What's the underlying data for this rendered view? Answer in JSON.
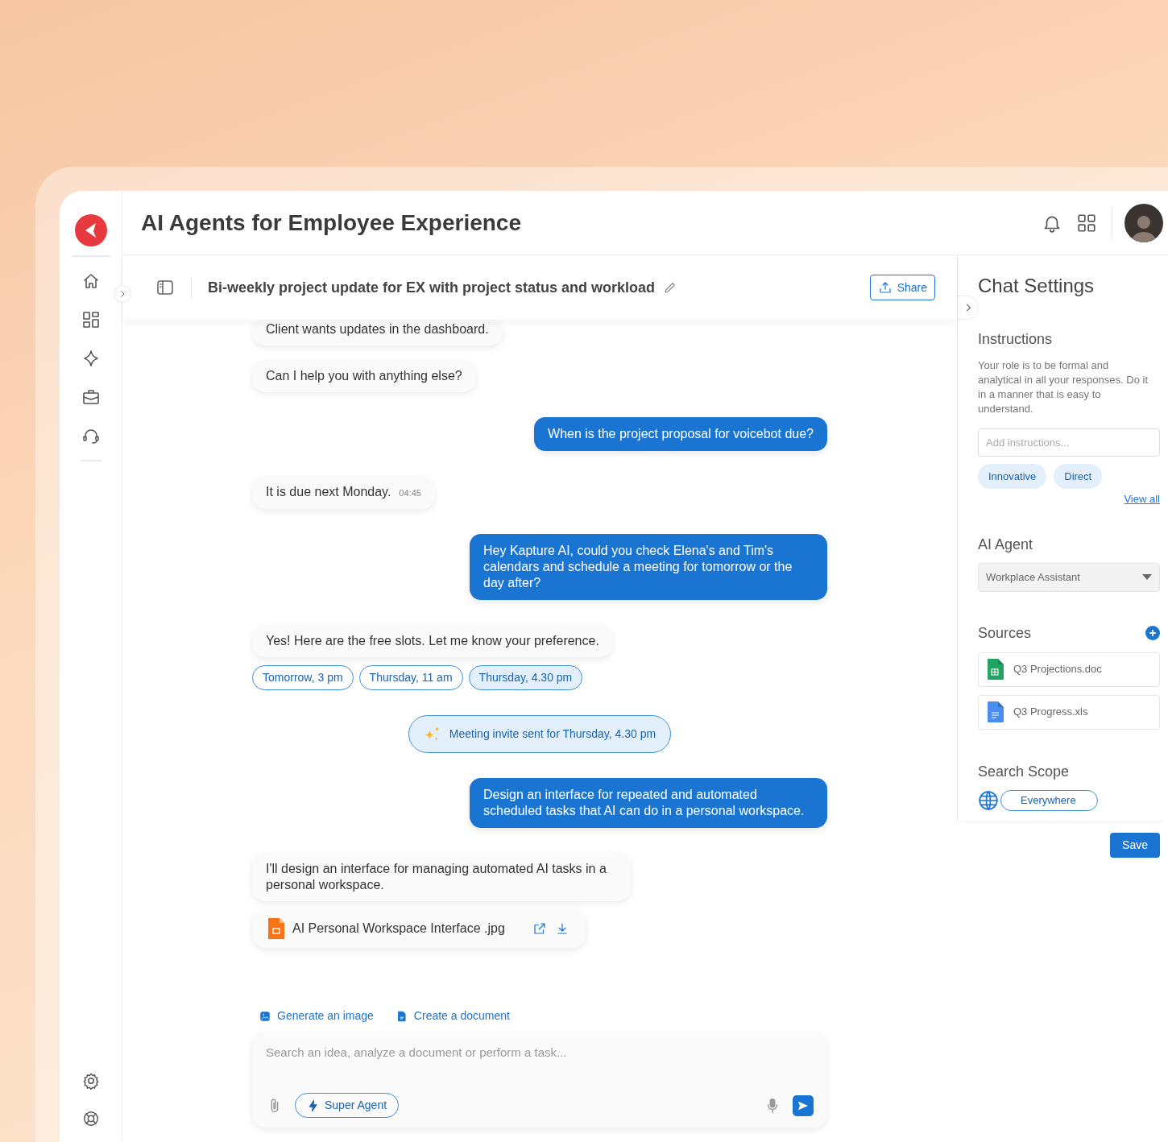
{
  "app": {
    "title": "AI Agents for Employee Experience"
  },
  "chat": {
    "title": "Bi-weekly project update for EX with project status and workload",
    "share_label": "Share",
    "messages": [
      {
        "kind": "bot",
        "text": "Client wants updates in the dashboard."
      },
      {
        "kind": "bot",
        "text": "Can I help you with anything else?"
      },
      {
        "kind": "user",
        "text": "When is the project proposal for voicebot due?"
      },
      {
        "kind": "bot",
        "text": "It is due next Monday.",
        "time": "04:45"
      },
      {
        "kind": "user",
        "text": "Hey Kapture AI, could you check Elena's and Tim's calendars and schedule a meeting for tomorrow or the day after?"
      },
      {
        "kind": "bot",
        "text": "Yes! Here are the free slots. Let me know your preference."
      },
      {
        "kind": "slots",
        "options": [
          {
            "label": "Tomorrow, 3 pm",
            "selected": false
          },
          {
            "label": "Thursday, 11 am",
            "selected": false
          },
          {
            "label": "Thursday, 4.30 pm",
            "selected": true
          }
        ]
      },
      {
        "kind": "notice",
        "text": "Meeting invite sent for Thursday, 4.30 pm"
      },
      {
        "kind": "user",
        "text": "Design an interface for repeated and automated scheduled tasks that AI can do in a personal workspace."
      },
      {
        "kind": "bot",
        "text": "I'll design an interface for managing automated AI tasks in a personal workspace."
      },
      {
        "kind": "file",
        "text": "AI Personal Workspace Interface .jpg"
      }
    ]
  },
  "composer": {
    "quick_actions": [
      {
        "kind": "image",
        "label": "Generate an image"
      },
      {
        "kind": "document",
        "label": "Create a document"
      }
    ],
    "placeholder": "Search an idea, analyze a document or perform a task...",
    "agent_label": "Super Agent"
  },
  "settings": {
    "title": "Chat Settings",
    "instructions_heading": "Instructions",
    "instructions_text": "Your role is to be formal and analytical in all your responses. Do it in a manner that is  easy to understand.",
    "instructions_placeholder": "Add instructions...",
    "tags": [
      "Innovative",
      "Direct"
    ],
    "view_all": "View all",
    "agent_heading": "AI Agent",
    "agent_value": "Workplace Assistant",
    "sources_heading": "Sources",
    "sources": [
      {
        "kind": "sheet",
        "name": "Q3 Projections.doc"
      },
      {
        "kind": "doc",
        "name": "Q3 Progress.xls"
      }
    ],
    "scope_heading": "Search Scope",
    "scope_value": "Everywhere",
    "save_label": "Save"
  }
}
